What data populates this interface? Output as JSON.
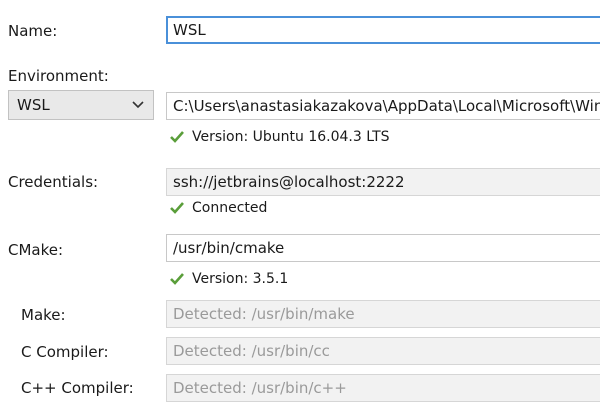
{
  "labels": {
    "name": "Name:",
    "environment": "Environment:",
    "credentials": "Credentials:",
    "cmake": "CMake:",
    "make": "Make:",
    "c_compiler": "C Compiler:",
    "cpp_compiler": "C++ Compiler:"
  },
  "name_field": {
    "value": "WSL"
  },
  "environment": {
    "selected": "WSL",
    "path": "C:\\Users\\anastasiakazakova\\AppData\\Local\\Microsoft\\WindowsApps",
    "status": "Version: Ubuntu 16.04.3 LTS"
  },
  "credentials": {
    "value": "ssh://jetbrains@localhost:2222",
    "status": "Connected"
  },
  "cmake": {
    "value": "/usr/bin/cmake",
    "status": "Version: 3.5.1"
  },
  "make": {
    "placeholder": "Detected: /usr/bin/make"
  },
  "c_compiler": {
    "placeholder": "Detected: /usr/bin/cc"
  },
  "cpp_compiler": {
    "placeholder": "Detected: /usr/bin/c++"
  },
  "colors": {
    "check": "#5a9e3a",
    "focus_border": "#4a90d9"
  }
}
